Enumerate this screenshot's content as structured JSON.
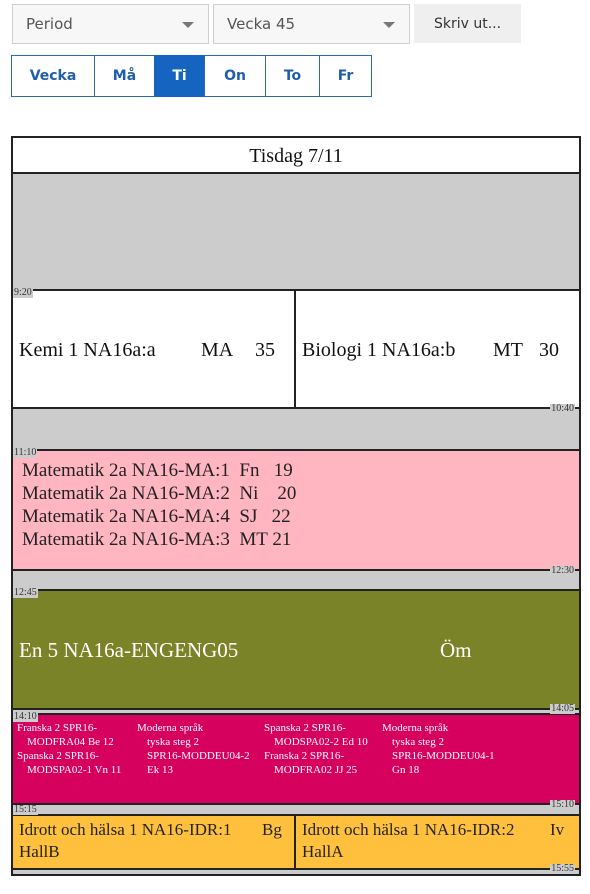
{
  "toolbar": {
    "period_select": {
      "value": "Period",
      "icon": "chevron-down-icon"
    },
    "week_select": {
      "value": "Vecka 45",
      "icon": "chevron-down-icon"
    },
    "print_label": "Skriv ut..."
  },
  "day_tabs": [
    {
      "label": "Vecka",
      "active": false
    },
    {
      "label": "Må",
      "active": false
    },
    {
      "label": "Ti",
      "active": true
    },
    {
      "label": "On",
      "active": false
    },
    {
      "label": "To",
      "active": false
    },
    {
      "label": "Fr",
      "active": false
    }
  ],
  "schedule": {
    "day_title": "Tisdag 7/11",
    "colors": {
      "break": "#cccccc",
      "kemi_biologi": "#ffffff",
      "matematik": "#ffb6c1",
      "engelska": "#7a8327",
      "sprak": "#d6005e",
      "idrott": "#ffc13d"
    },
    "blocks": [
      {
        "start": "9:20",
        "end": "10:40",
        "lessons": [
          {
            "course": "Kemi 1 NA16a:a",
            "teacher": "MA",
            "room": "35"
          },
          {
            "course": "Biologi 1 NA16a:b",
            "teacher": "MT",
            "room": "30"
          }
        ]
      },
      {
        "start": "11:10",
        "end": "12:30",
        "lines": [
          {
            "course": "Matematik 2a NA16-MA:1",
            "teacher": "Fn",
            "room": "19"
          },
          {
            "course": "Matematik 2a NA16-MA:2",
            "teacher": "Ni",
            "room": "20"
          },
          {
            "course": "Matematik 2a NA16-MA:4",
            "teacher": "SJ",
            "room": "22"
          },
          {
            "course": "Matematik 2a NA16-MA:3",
            "teacher": "MT",
            "room": "21"
          }
        ]
      },
      {
        "start": "12:45",
        "end": "14:05",
        "course": "En 5 NA16a-ENGENG05",
        "teacher": "Öm"
      },
      {
        "start": "14:10",
        "end": "15:10",
        "columns": [
          [
            {
              "l1": "Franska 2 SPR16-",
              "l2": "MODFRA04 Be 12"
            },
            {
              "l1": "Spanska 2 SPR16-",
              "l2": "MODSPA02-1 Vn 11"
            }
          ],
          [
            {
              "l1": "Moderna språk",
              "l2": "tyska steg 2",
              "l3": "SPR16-MODDEU04-2",
              "l4": "Ek 13"
            }
          ],
          [
            {
              "l1": "Spanska 2 SPR16-",
              "l2": "MODSPA02-2 Ed 10"
            },
            {
              "l1": "Franska 2 SPR16-",
              "l2": "MODFRA02 JJ 25"
            }
          ],
          [
            {
              "l1": "Moderna språk",
              "l2": "tyska steg 2",
              "l3": "SPR16-MODDEU04-1",
              "l4": "Gn 18"
            }
          ]
        ]
      },
      {
        "start": "15:15",
        "end": "15:55",
        "lessons": [
          {
            "line1": "Idrott och hälsa 1 NA16-IDR:1",
            "teacher": "Bg",
            "room": "HallB"
          },
          {
            "line1": "Idrott och hälsa 1 NA16-IDR:2",
            "teacher": "Iv",
            "room": "HallA"
          }
        ]
      }
    ]
  }
}
